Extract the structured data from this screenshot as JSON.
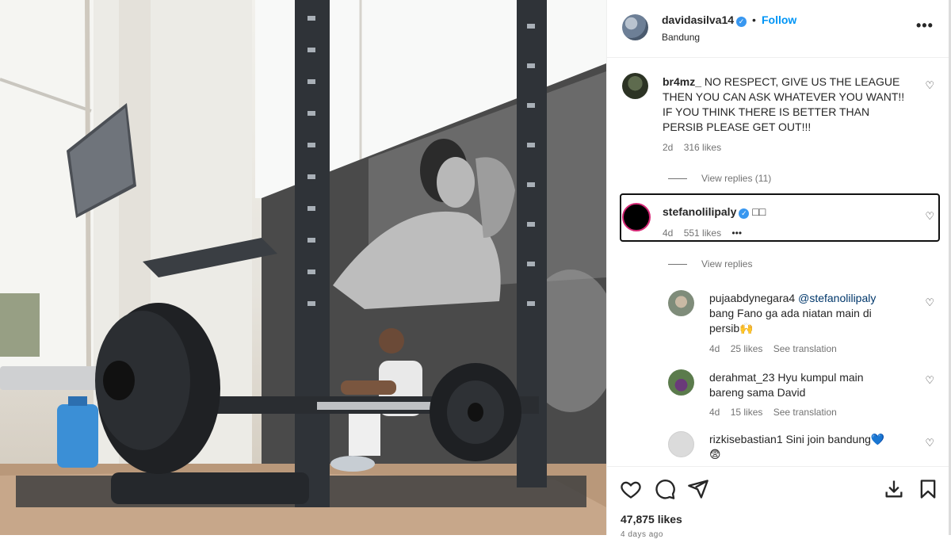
{
  "post": {
    "username": "davidasilva14",
    "follow_label": "Follow",
    "separator": "•",
    "location": "Bandung",
    "more": "•••",
    "likes": "47,875 likes",
    "time_partial": "4 days ago"
  },
  "comments": [
    {
      "username": "br4mz_",
      "text": "NO RESPECT, GIVE US THE LEAGUE THEN YOU CAN ASK WHATEVER YOU WANT!! IF YOU THINK THERE IS BETTER THAN PERSIB PLEASE GET OUT!!!",
      "age": "2d",
      "likes": "316 likes",
      "view_replies": "View replies (11)"
    },
    {
      "username": "stefanolilipaly",
      "text": "□□",
      "age": "4d",
      "likes": "551 likes",
      "more": "•••",
      "view_replies": "View replies"
    }
  ],
  "replies": [
    {
      "username": "pujaabdynegara4",
      "mention": "@stefanolilipaly",
      "text": "bang Fano ga ada niatan main di persib",
      "emoji": "🙌",
      "age": "4d",
      "likes": "25 likes",
      "translate": "See translation"
    },
    {
      "username": "derahmat_23",
      "text": "Hyu kumpul main bareng sama David",
      "age": "4d",
      "likes": "15 likes",
      "translate": "See translation"
    },
    {
      "username": "rizkisebastian1",
      "text": "Sini join bandung",
      "emoji": "💙",
      "emoji2": "😨"
    }
  ],
  "icons": {
    "verified": "✓",
    "heart": "♡"
  },
  "colors": {
    "follow": "#0095f6",
    "verified": "#3897f0",
    "highlight_border": "#111111"
  }
}
